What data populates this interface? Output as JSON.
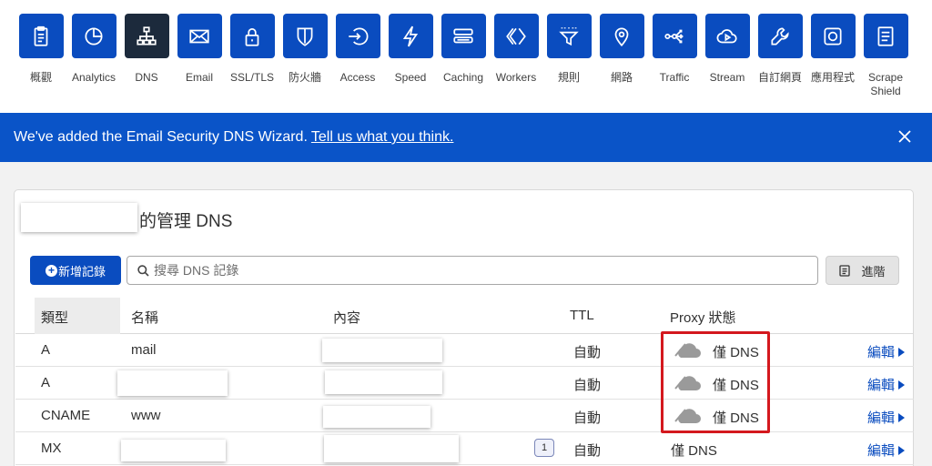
{
  "nav": {
    "items": [
      {
        "label": "概觀",
        "icon": "clipboard-icon"
      },
      {
        "label": "Analytics",
        "icon": "pie-chart-icon"
      },
      {
        "label": "DNS",
        "icon": "network-icon",
        "active": true
      },
      {
        "label": "Email",
        "icon": "envelope-icon"
      },
      {
        "label": "SSL/TLS",
        "icon": "lock-icon"
      },
      {
        "label": "防火牆",
        "icon": "shield-icon"
      },
      {
        "label": "Access",
        "icon": "access-arrow-icon"
      },
      {
        "label": "Speed",
        "icon": "lightning-icon"
      },
      {
        "label": "Caching",
        "icon": "server-stack-icon"
      },
      {
        "label": "Workers",
        "icon": "workers-icon"
      },
      {
        "label": "規則",
        "icon": "funnel-icon"
      },
      {
        "label": "網路",
        "icon": "location-pin-icon"
      },
      {
        "label": "Traffic",
        "icon": "traffic-share-icon"
      },
      {
        "label": "Stream",
        "icon": "cloud-play-icon"
      },
      {
        "label": "自訂網頁",
        "icon": "wrench-icon"
      },
      {
        "label": "應用程式",
        "icon": "app-square-icon"
      },
      {
        "label": "Scrape Shield",
        "icon": "document-icon"
      }
    ]
  },
  "banner": {
    "text": "We've added the Email Security DNS Wizard.",
    "link": "Tell us what you think."
  },
  "card": {
    "title_suffix": "的管理 DNS"
  },
  "toolbar": {
    "add_label": "新增記錄",
    "search_placeholder": "搜尋 DNS 記錄",
    "advanced_label": "進階"
  },
  "table": {
    "headers": {
      "type": "類型",
      "name": "名稱",
      "content": "內容",
      "ttl": "TTL",
      "proxy": "Proxy 狀態"
    },
    "edit_label": "編輯",
    "rows": [
      {
        "type": "A",
        "name": "mail",
        "ttl": "自動",
        "proxy": "僅 DNS"
      },
      {
        "type": "A",
        "name": "",
        "ttl": "自動",
        "proxy": "僅 DNS"
      },
      {
        "type": "CNAME",
        "name": "www",
        "ttl": "自動",
        "proxy": "僅 DNS"
      },
      {
        "type": "MX",
        "name": "",
        "priority": "1",
        "ttl": "自動",
        "proxy": "僅 DNS"
      }
    ]
  },
  "colors": {
    "brand_blue": "#0a4cbf",
    "banner_blue": "#0a54c8",
    "active_tile": "#1c2a3c",
    "highlight_red": "#d4181e"
  }
}
